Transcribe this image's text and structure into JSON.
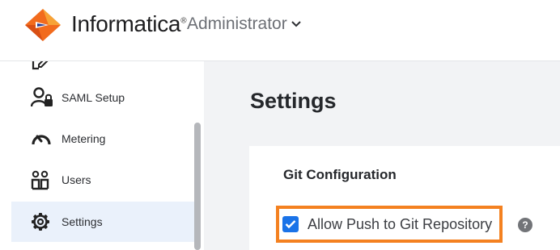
{
  "header": {
    "brand": "Informatica",
    "brand_mark": "®",
    "app_name": "Administrator",
    "logo_icon": "informatica-diamond-logo",
    "dropdown_icon": "chevron-down-icon"
  },
  "sidebar": {
    "items": [
      {
        "label": "",
        "icon": "edit-icon",
        "active": false
      },
      {
        "label": "SAML Setup",
        "icon": "user-lock-icon",
        "active": false
      },
      {
        "label": "Metering",
        "icon": "gauge-icon",
        "active": false
      },
      {
        "label": "Users",
        "icon": "users-icon",
        "active": false
      },
      {
        "label": "Settings",
        "icon": "gear-icon",
        "active": true
      }
    ]
  },
  "main": {
    "title": "Settings",
    "section_title": "Git Configuration",
    "checkbox_label": "Allow Push to Git Repository",
    "checkbox_checked": true,
    "help_glyph": "?",
    "help_icon": "help-icon"
  },
  "colors": {
    "highlight": "#f48120",
    "checkbox": "#1a73e8",
    "active_nav": "#eaf1fb",
    "main_bg": "#f2f3f5"
  }
}
